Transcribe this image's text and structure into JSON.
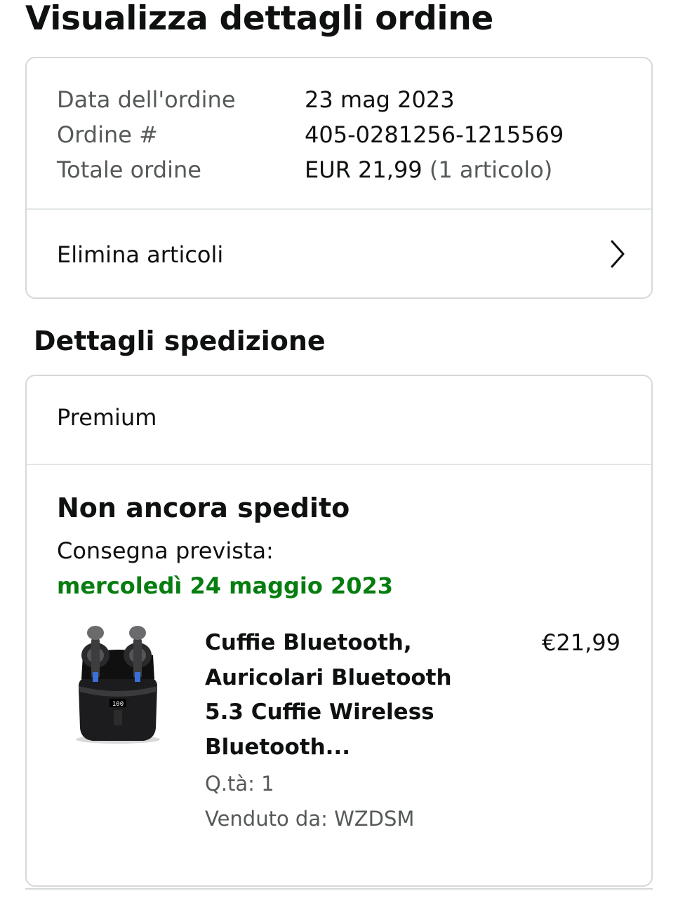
{
  "page": {
    "title": "Visualizza dettagli ordine"
  },
  "summary": {
    "rows": [
      {
        "label": "Data dell'ordine",
        "value": "23 mag 2023"
      },
      {
        "label": "Ordine #",
        "value": "405-0281256-1215569"
      },
      {
        "label": "Totale ordine",
        "value": "EUR 21,99",
        "extra": "(1 articolo)"
      }
    ],
    "delete_label": "Elimina articoli"
  },
  "shipping": {
    "section_title": "Dettagli spedizione",
    "type": "Premium",
    "status": "Non ancora spedito",
    "delivery_label": "Consegna prevista:",
    "delivery_date": "mercoledì 24 maggio 2023",
    "delivery_color": "#067d10"
  },
  "product": {
    "image_icon": "earbuds-product-image",
    "title": "Cuffie Bluetooth, Auricolari Bluetooth 5.3 Cuffie Wireless Bluetooth...",
    "price": "€21,99",
    "qty": "Q.tà: 1",
    "seller": "Venduto da: WZDSM",
    "case_display": "100"
  }
}
